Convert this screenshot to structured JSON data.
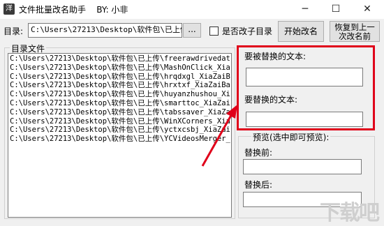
{
  "window": {
    "title": "文件批量改名助手    BY: 小非",
    "icon_glyph": "洋",
    "min_glyph": "─",
    "max_glyph": "☐",
    "close_glyph": "✕"
  },
  "directory": {
    "label": "目录:",
    "value": "C:\\Users\\27213\\Desktop\\软件包\\已上传",
    "browse_label": "...",
    "checkbox_label": "是否改子目录",
    "checkbox_checked": false
  },
  "buttons": {
    "start": "开始改名",
    "restore_line1": "恢复到上一",
    "restore_line2": "次改名前"
  },
  "file_list": {
    "title": "目录文件",
    "items": [
      "C:\\Users\\27213\\Desktop\\软件包\\已上传\\freerawdrivedat",
      "C:\\Users\\27213\\Desktop\\软件包\\已上传\\MashOnClick_Xia",
      "C:\\Users\\27213\\Desktop\\软件包\\已上传\\hrqdxgl_XiaZaiB",
      "C:\\Users\\27213\\Desktop\\软件包\\已上传\\hrxtxf_XiaZaiBa",
      "C:\\Users\\27213\\Desktop\\软件包\\已上传\\huyanzhushou_Xi",
      "C:\\Users\\27213\\Desktop\\软件包\\已上传\\smarttoc_XiaZai",
      "C:\\Users\\27213\\Desktop\\软件包\\已上传\\tabssaver_XiaZa",
      "C:\\Users\\27213\\Desktop\\软件包\\已上传\\WinXCorners_Xia",
      "C:\\Users\\27213\\Desktop\\软件包\\已上传\\yctxcsbj_XiaZai",
      "C:\\Users\\27213\\Desktop\\软件包\\已上传\\YCVideosMerger_"
    ]
  },
  "replace": {
    "find_label": "要被替换的文本:",
    "find_value": "",
    "replace_label": "要替换的文本:",
    "replace_value": ""
  },
  "preview": {
    "title": "预览(选中即可预览):",
    "before_label": "替换前:",
    "before_value": "",
    "after_label": "替换后:",
    "after_value": ""
  },
  "watermark": "下载吧",
  "colors": {
    "highlight": "#e0001a",
    "arrow": "#e0001a",
    "window_bg": "#f0f0f0"
  }
}
